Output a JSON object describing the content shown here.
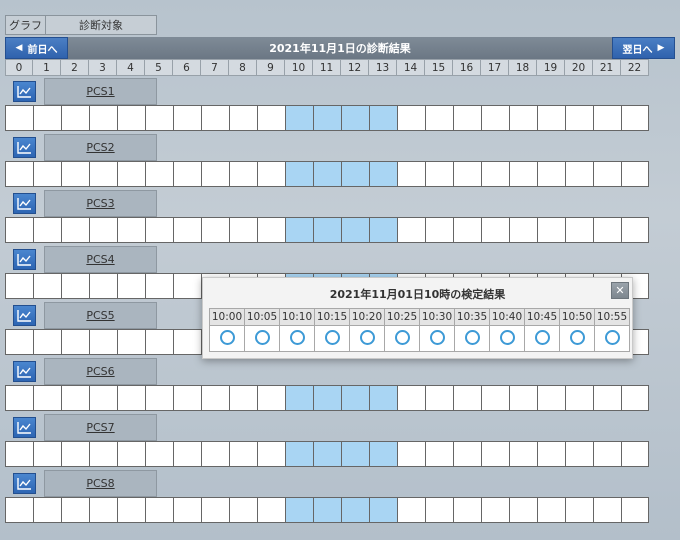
{
  "header": {
    "graph_label": "グラフ",
    "target_label": "診断対象"
  },
  "nav": {
    "prev_label": "前日へ",
    "next_label": "翌日へ",
    "title": "2021年11月1日の診断結果"
  },
  "hours": [
    "0",
    "1",
    "2",
    "3",
    "4",
    "5",
    "6",
    "7",
    "8",
    "9",
    "10",
    "11",
    "12",
    "13",
    "14",
    "15",
    "16",
    "17",
    "18",
    "19",
    "20",
    "21",
    "22"
  ],
  "selected_hours": [
    10,
    11,
    12,
    13
  ],
  "devices": [
    {
      "name": "PCS1"
    },
    {
      "name": "PCS2"
    },
    {
      "name": "PCS3"
    },
    {
      "name": "PCS4"
    },
    {
      "name": "PCS5"
    },
    {
      "name": "PCS6"
    },
    {
      "name": "PCS7"
    },
    {
      "name": "PCS8"
    }
  ],
  "popup": {
    "title": "2021年11月01日10時の検定結果",
    "close_label": "✕",
    "times": [
      "10:00",
      "10:05",
      "10:10",
      "10:15",
      "10:20",
      "10:25",
      "10:30",
      "10:35",
      "10:40",
      "10:45",
      "10:50",
      "10:55"
    ],
    "results": [
      "ok",
      "ok",
      "ok",
      "ok",
      "ok",
      "ok",
      "ok",
      "ok",
      "ok",
      "ok",
      "ok",
      "ok"
    ]
  },
  "colors": {
    "accent": "#2f62ad",
    "selected_slot": "#a9d5f3",
    "ok_mark": "#3d9ad6"
  },
  "icons": {
    "graph_button": "line-chart-icon",
    "prev": "triangle-left-icon",
    "next": "triangle-right-icon"
  }
}
